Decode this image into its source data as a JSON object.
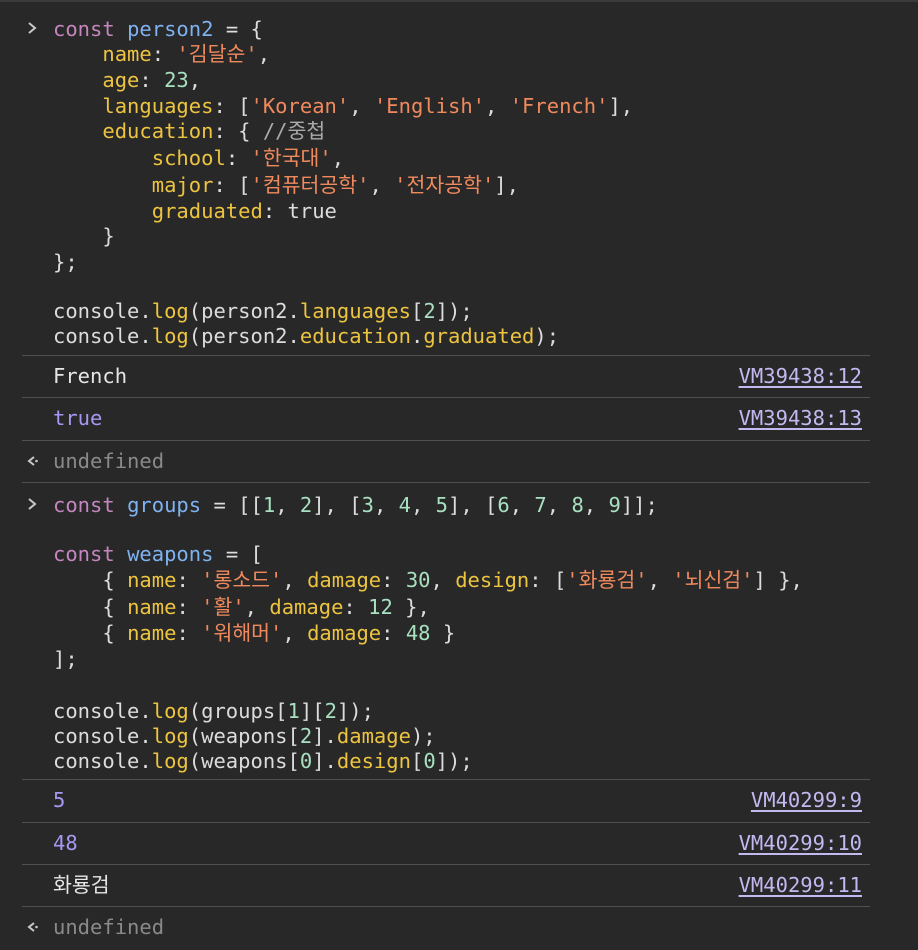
{
  "entries": [
    {
      "input_lines": [
        "const person2 = {",
        "    name: '김달순',",
        "    age: 23,",
        "    languages: ['Korean', 'English', 'French'],",
        "    education: { //중첩",
        "        school: '한국대',",
        "        major: ['컴퓨터공학', '전자공학'],",
        "        graduated: true",
        "    }",
        "};",
        "",
        "console.log(person2.languages[2]);",
        "console.log(person2.education.graduated);"
      ],
      "outputs": [
        {
          "value": "French",
          "source": "VM39438:12"
        },
        {
          "value": "true",
          "source": "VM39438:13"
        }
      ],
      "return_value": "undefined"
    },
    {
      "input_lines": [
        "const groups = [[1, 2], [3, 4, 5], [6, 7, 8, 9]];",
        "",
        "const weapons = [",
        "    { name: '롱소드', damage: 30, design: ['화룡검', '뇌신검'] },",
        "    { name: '활', damage: 12 },",
        "    { name: '워해머', damage: 48 }",
        "];",
        "",
        "console.log(groups[1][2]);",
        "console.log(weapons[2].damage);",
        "console.log(weapons[0].design[0]);"
      ],
      "outputs": [
        {
          "value": "5",
          "source": "VM40299:9"
        },
        {
          "value": "48",
          "source": "VM40299:10"
        },
        {
          "value": "화룡검",
          "source": "VM40299:11"
        }
      ],
      "return_value": "undefined"
    }
  ],
  "icons": {
    "input_prompt": "chevron-right-icon",
    "return_prompt": "return-arrow-icon"
  },
  "colors": {
    "background": "#282828",
    "keyword": "#c586c0",
    "variable": "#7fb2f0",
    "property": "#ecc440",
    "string": "#f08a5d",
    "number": "#a8e0c0",
    "link": "#c4b8f0",
    "number_output": "#a897f2"
  }
}
